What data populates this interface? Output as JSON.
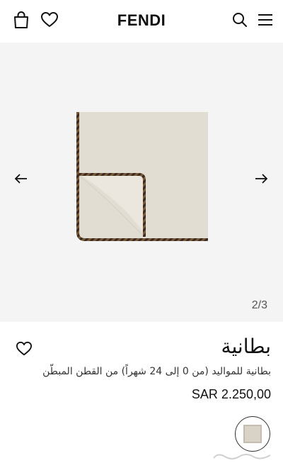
{
  "header": {
    "brand": "FENDI",
    "icons": [
      "shopping-bag-icon",
      "heart-icon",
      "search-icon",
      "menu-icon"
    ]
  },
  "gallery": {
    "counter": "2/3",
    "prev_icon": "arrow-left-icon",
    "next_icon": "arrow-right-icon",
    "background_color": "#f4f4f4"
  },
  "product": {
    "title": "بطانية",
    "subtitle": "بطانية للمواليد (من 0 إلى 24 شهراً) من القطن المبطّن",
    "price": "SAR 2.250,00",
    "swatch_color": "#d9d3c7",
    "wishlist_icon": "heart-icon"
  }
}
